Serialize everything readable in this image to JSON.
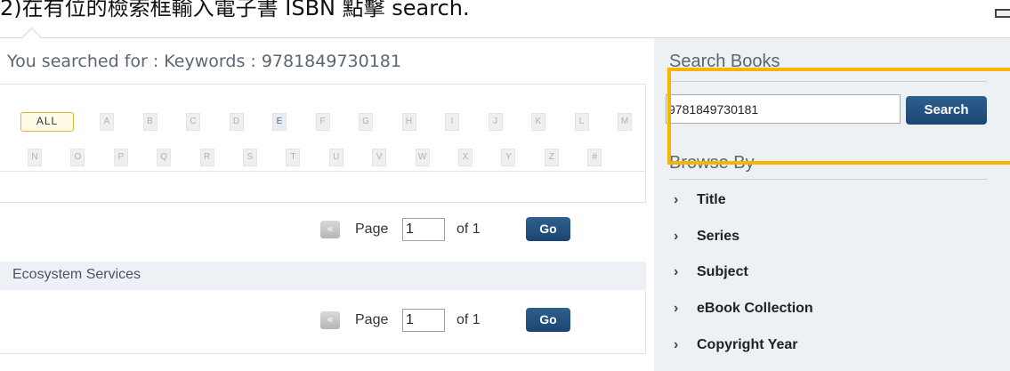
{
  "caption": "2)在有位的檢索框輸入電子書 ISBN 點擊 search.",
  "results": {
    "searched_for": "You searched for : Keywords : 9781849730181"
  },
  "alphabet": {
    "all_label": "ALL",
    "row1": [
      "A",
      "B",
      "C",
      "D",
      "E",
      "F",
      "G",
      "H",
      "I",
      "J",
      "K",
      "L",
      "M"
    ],
    "row2": [
      "N",
      "O",
      "P",
      "Q",
      "R",
      "S",
      "T",
      "U",
      "V",
      "W",
      "X",
      "Y",
      "Z",
      "#"
    ],
    "active": "E"
  },
  "pager": {
    "prev_icon": "double-left-chevron-icon",
    "prev_glyph": "«",
    "page_label": "Page",
    "page_value": "1",
    "of_label": "of 1",
    "go_label": "Go"
  },
  "result_item": {
    "title": "Ecosystem Services"
  },
  "sidebar": {
    "search_title": "Search Books",
    "search_value": "9781849730181",
    "search_button": "Search",
    "browse_title": "Browse By",
    "browse_items": [
      {
        "label": "Title"
      },
      {
        "label": "Series"
      },
      {
        "label": "Subject"
      },
      {
        "label": "eBook Collection"
      },
      {
        "label": "Copyright Year"
      }
    ]
  },
  "colors": {
    "accent_blue": "#1b4673",
    "highlight": "#f7b400",
    "sidebar_bg": "#edf1f4"
  }
}
